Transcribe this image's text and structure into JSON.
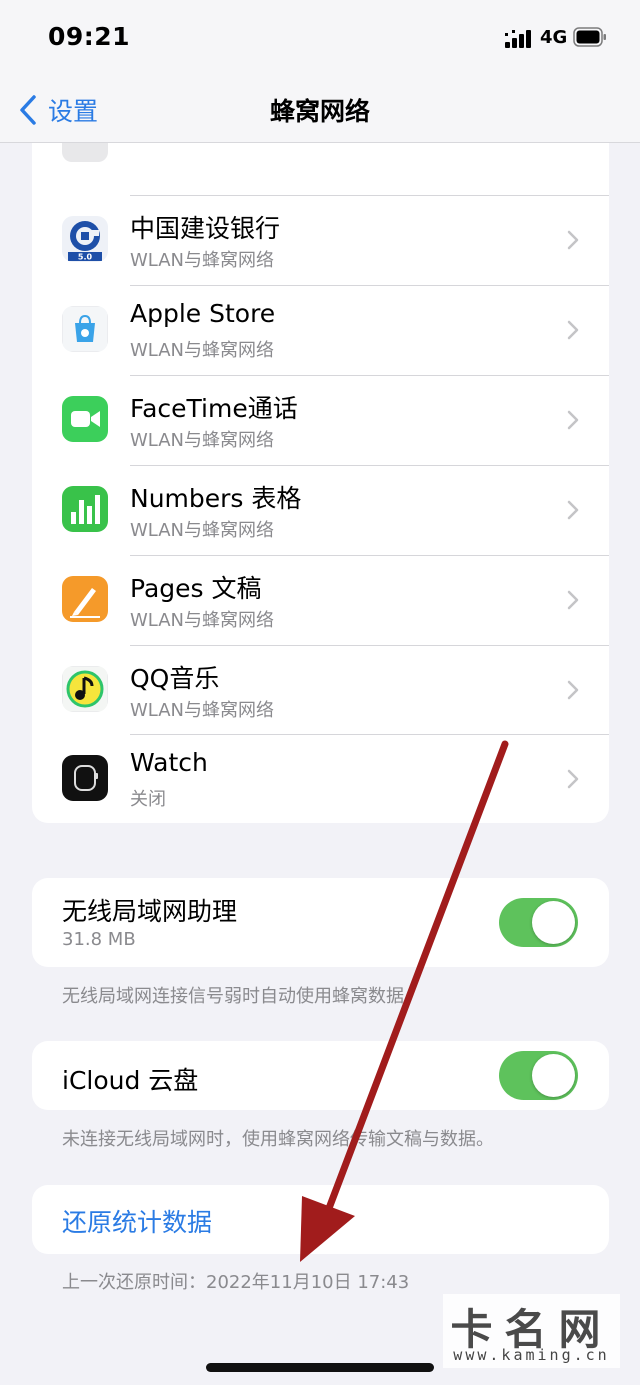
{
  "status_bar": {
    "time": "09:21",
    "network": "4G"
  },
  "nav": {
    "back_label": "设置",
    "title": "蜂窝网络"
  },
  "apps": [
    {
      "name": "中国建设银行",
      "sub": "WLAN与蜂窝网络",
      "icon": "ccb-bank-icon"
    },
    {
      "name": "Apple Store",
      "sub": "WLAN与蜂窝网络",
      "icon": "apple-store-icon"
    },
    {
      "name": "FaceTime通话",
      "sub": "WLAN与蜂窝网络",
      "icon": "facetime-icon"
    },
    {
      "name": "Numbers 表格",
      "sub": "WLAN与蜂窝网络",
      "icon": "numbers-icon"
    },
    {
      "name": "Pages 文稿",
      "sub": "WLAN与蜂窝网络",
      "icon": "pages-icon"
    },
    {
      "name": "QQ音乐",
      "sub": "WLAN与蜂窝网络",
      "icon": "qq-music-icon"
    },
    {
      "name": "Watch",
      "sub": "关闭",
      "icon": "watch-icon"
    }
  ],
  "wifi_assist": {
    "title": "无线局域网助理",
    "size": "31.8 MB",
    "enabled": true,
    "footnote": "无线局域网连接信号弱时自动使用蜂窝数据。"
  },
  "icloud_drive": {
    "title": "iCloud 云盘",
    "enabled": true,
    "footnote": "未连接无线局域网时，使用蜂窝网络传输文稿与数据。"
  },
  "reset": {
    "label": "还原统计数据",
    "last_reset": "上一次还原时间：2022年11月10日 17:43"
  },
  "watermark": {
    "text": "卡名网",
    "url": "www.kaming.cn"
  },
  "colors": {
    "accent_blue": "#2a7be4",
    "toggle_green": "#5ec25c",
    "annotation_arrow": "#a11c1c"
  }
}
